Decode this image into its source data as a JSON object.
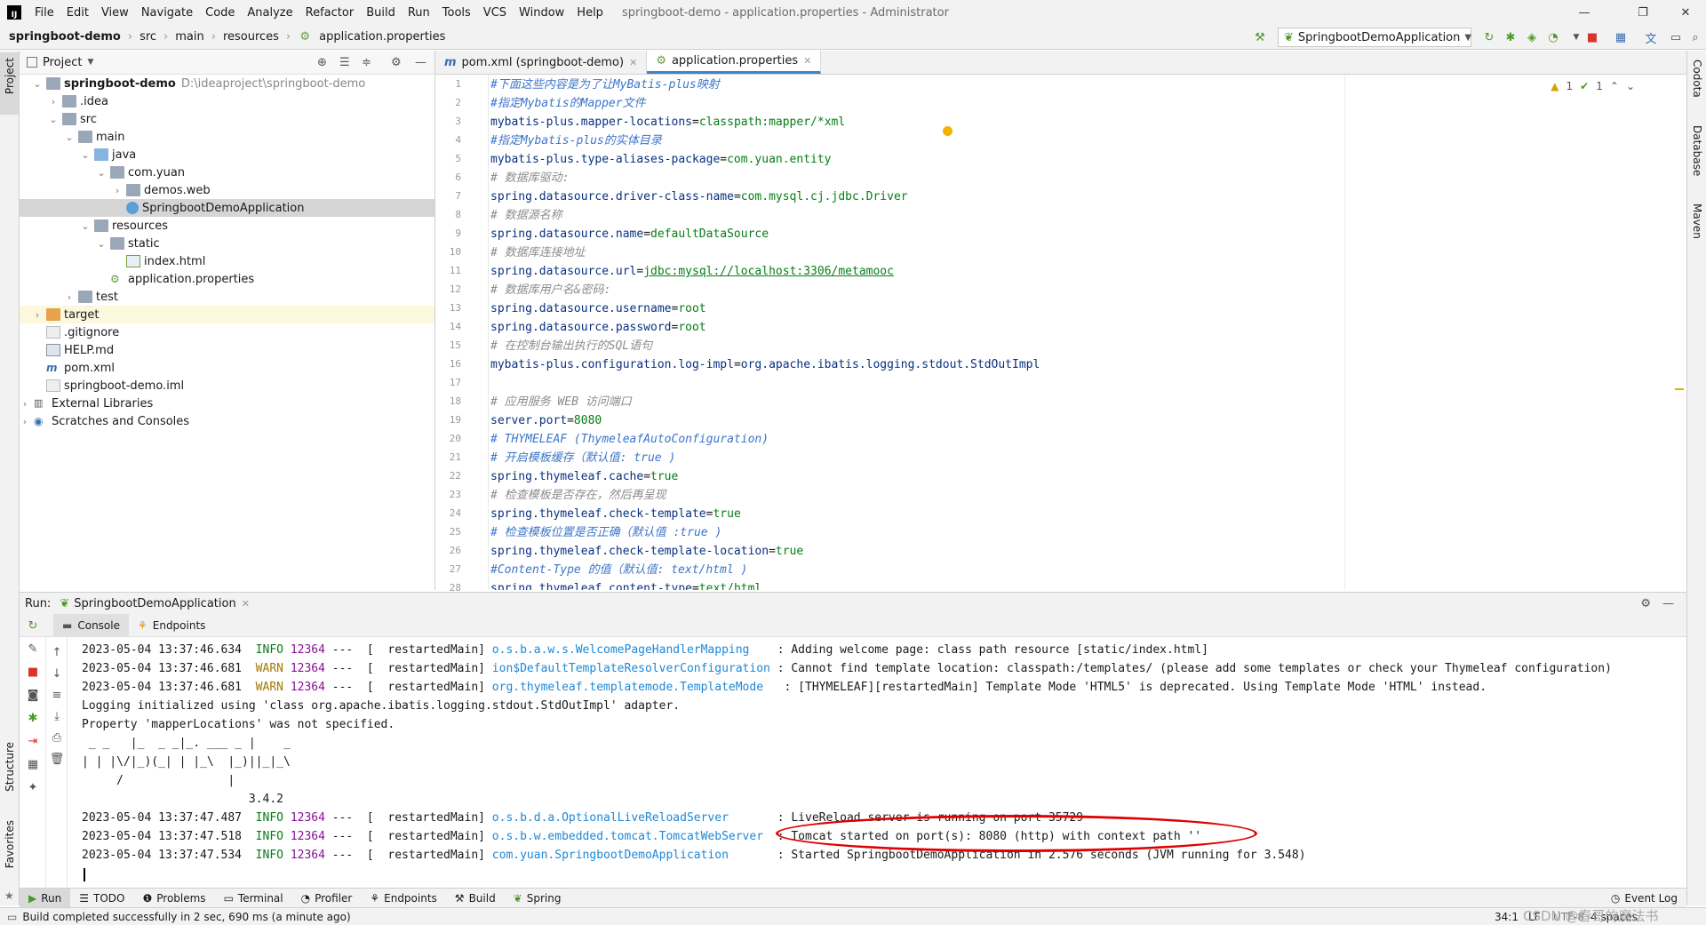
{
  "menubar": {
    "items": [
      "File",
      "Edit",
      "View",
      "Navigate",
      "Code",
      "Analyze",
      "Refactor",
      "Build",
      "Run",
      "Tools",
      "VCS",
      "Window",
      "Help"
    ],
    "title": "springboot-demo - application.properties - Administrator"
  },
  "navbar": {
    "crumbs": [
      "springboot-demo",
      "src",
      "main",
      "resources",
      "application.properties"
    ],
    "run_config": "SpringbootDemoApplication"
  },
  "left_strip": {
    "project": "Project",
    "structure": "Structure",
    "favorites": "Favorites"
  },
  "right_strip": {
    "codota": "Codota",
    "database": "Database",
    "maven": "Maven"
  },
  "project": {
    "header": "Project",
    "tree": [
      {
        "label": "springboot-demo",
        "extra": "D:\\ideaproject\\springboot-demo"
      },
      {
        "label": ".idea"
      },
      {
        "label": "src"
      },
      {
        "label": "main"
      },
      {
        "label": "java"
      },
      {
        "label": "com.yuan"
      },
      {
        "label": "demos.web"
      },
      {
        "label": "SpringbootDemoApplication"
      },
      {
        "label": "resources"
      },
      {
        "label": "static"
      },
      {
        "label": "index.html"
      },
      {
        "label": "application.properties"
      },
      {
        "label": "test"
      },
      {
        "label": "target"
      },
      {
        "label": ".gitignore"
      },
      {
        "label": "HELP.md"
      },
      {
        "label": "pom.xml"
      },
      {
        "label": "springboot-demo.iml"
      },
      {
        "label": "External Libraries"
      },
      {
        "label": "Scratches and Consoles"
      }
    ]
  },
  "editor": {
    "tabs": [
      "pom.xml (springboot-demo)",
      "application.properties"
    ],
    "inspections": {
      "warnings": "1",
      "ok": "1"
    },
    "lines": [
      {
        "n": "1",
        "text": "#下面这些内容是为了让MyBatis-plus映射",
        "kind": "cm-b"
      },
      {
        "n": "2",
        "text": "#指定Mybatis的Mapper文件",
        "kind": "cm-b"
      },
      {
        "n": "3",
        "key": "mybatis-plus.mapper-locations",
        "val": "classpath:mapper/*xml"
      },
      {
        "n": "4",
        "text": "#指定Mybatis-plus的实体目录",
        "kind": "cm-b"
      },
      {
        "n": "5",
        "key": "mybatis-plus.type-aliases-package",
        "val": "com.yuan.entity"
      },
      {
        "n": "6",
        "text": "# 数据库驱动:",
        "kind": "cm"
      },
      {
        "n": "7",
        "key": "spring.datasource.driver-class-name",
        "val": "com.mysql.cj.jdbc.Driver"
      },
      {
        "n": "8",
        "text": "# 数据源名称",
        "kind": "cm"
      },
      {
        "n": "9",
        "key": "spring.datasource.name",
        "val": "defaultDataSource"
      },
      {
        "n": "10",
        "text": "# 数据库连接地址",
        "kind": "cm"
      },
      {
        "n": "11",
        "key": "spring.datasource.url",
        "val": "jdbc:mysql://localhost:3306/metamooc",
        "link": true
      },
      {
        "n": "12",
        "text": "# 数据库用户名&密码:",
        "kind": "cm"
      },
      {
        "n": "13",
        "key": "spring.datasource.username",
        "val": "root"
      },
      {
        "n": "14",
        "key": "spring.datasource.password",
        "val": "root"
      },
      {
        "n": "15",
        "text": "# 在控制台输出执行的SQL语句",
        "kind": "cm"
      },
      {
        "n": "16",
        "key": "mybatis-plus.configuration.log-impl",
        "val": "org.apache.ibatis.logging.stdout.StdOutImpl",
        "plainval": true
      },
      {
        "n": "17",
        "text": "",
        "kind": "cm"
      },
      {
        "n": "18",
        "text": "# 应用服务 WEB 访问端口",
        "kind": "cm"
      },
      {
        "n": "19",
        "key": "server.port",
        "val": "8080"
      },
      {
        "n": "20",
        "text": "# THYMELEAF (ThymeleafAutoConfiguration)",
        "kind": "cm-b"
      },
      {
        "n": "21",
        "text": "# 开启模板缓存（默认值: true )",
        "kind": "cm-b"
      },
      {
        "n": "22",
        "key": "spring.thymeleaf.cache",
        "val": "true"
      },
      {
        "n": "23",
        "text": "# 检查模板是否存在，然后再呈现",
        "kind": "cm"
      },
      {
        "n": "24",
        "key": "spring.thymeleaf.check-template",
        "val": "true"
      },
      {
        "n": "25",
        "text": "# 检查模板位置是否正确（默认值 :true )",
        "kind": "cm-b"
      },
      {
        "n": "26",
        "key": "spring.thymeleaf.check-template-location",
        "val": "true"
      },
      {
        "n": "27",
        "text": "#Content-Type 的值（默认值: text/html )",
        "kind": "cm-b"
      },
      {
        "n": "28",
        "key": "spring.thymeleaf.content-type",
        "val": "text/html"
      }
    ]
  },
  "run": {
    "label": "Run:",
    "config": "SpringbootDemoApplication",
    "subtabs": [
      "Console",
      "Endpoints"
    ],
    "console": [
      {
        "ts": "2023-05-04 13:37:46.634",
        "lvl": "INFO",
        "pid": "12364",
        "thread": "---  [  restartedMain]",
        "logger": "o.s.b.a.w.s.WelcomePageHandlerMapping   ",
        "msg": " : Adding welcome page: class path resource [static/index.html]"
      },
      {
        "ts": "2023-05-04 13:37:46.681",
        "lvl": "WARN",
        "pid": "12364",
        "thread": "---  [  restartedMain]",
        "logger": "ion$DefaultTemplateResolverConfiguration",
        "msg": " : Cannot find template location: classpath:/templates/ (please add some templates or check your Thymeleaf configuration)"
      },
      {
        "ts": "2023-05-04 13:37:46.681",
        "lvl": "WARN",
        "pid": "12364",
        "thread": "---  [  restartedMain]",
        "logger": "org.thymeleaf.templatemode.TemplateMode  ",
        "msg": " : [THYMELEAF][restartedMain] Template Mode 'HTML5' is deprecated. Using Template Mode 'HTML' instead."
      },
      {
        "plain": "Logging initialized using 'class org.apache.ibatis.logging.stdout.StdOutImpl' adapter."
      },
      {
        "plain": "Property 'mapperLocations' was not specified."
      },
      {
        "plain": " _ _   |_  _ _|_. ___ _ |    _"
      },
      {
        "plain": "| | |\\/|_)(_| | |_\\  |_)||_|_\\"
      },
      {
        "plain": "     /               |"
      },
      {
        "plain": "                        3.4.2"
      },
      {
        "ts": "2023-05-04 13:37:47.487",
        "lvl": "INFO",
        "pid": "12364",
        "thread": "---  [  restartedMain]",
        "logger": "o.s.b.d.a.OptionalLiveReloadServer      ",
        "msg": " : LiveReload server is running on port 35729"
      },
      {
        "ts": "2023-05-04 13:37:47.518",
        "lvl": "INFO",
        "pid": "12364",
        "thread": "---  [  restartedMain]",
        "logger": "o.s.b.w.embedded.tomcat.TomcatWebServer ",
        "msg": " : Tomcat started on port(s): 8080 (http) with context path ''"
      },
      {
        "ts": "2023-05-04 13:37:47.534",
        "lvl": "INFO",
        "pid": "12364",
        "thread": "---  [  restartedMain]",
        "logger": "com.yuan.SpringbootDemoApplication      ",
        "msg": " : Started SpringbootDemoApplication in 2.576 seconds (JVM running for 3.548)"
      }
    ]
  },
  "bottom_tabs": [
    "Run",
    "TODO",
    "Problems",
    "Terminal",
    "Profiler",
    "Endpoints",
    "Build",
    "Spring"
  ],
  "event_log": "Event Log",
  "status": {
    "message": "Build completed successfully in 2 sec, 690 ms (a minute ago)",
    "position": "34:1",
    "line_sep": "LF",
    "encoding": "UTF-8",
    "indent": "4 spaces",
    "watermark": "CSDN @春哥的魔法书"
  },
  "colors": {
    "accent": "#4083c9",
    "highlight": "#e00000"
  }
}
